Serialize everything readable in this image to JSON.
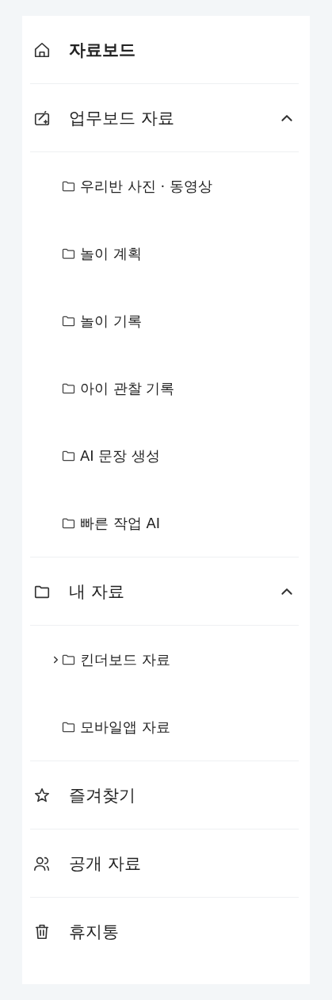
{
  "sidebar": {
    "items": [
      {
        "kind": "link",
        "label": "자료보드",
        "selected": true
      },
      {
        "kind": "group",
        "label": "업무보드 자료",
        "selected": false,
        "expanded": true,
        "children": [
          {
            "label": "우리반 사진 · 동영상",
            "expandable": false
          },
          {
            "label": "놀이 계획",
            "expandable": false
          },
          {
            "label": "놀이 기록",
            "expandable": false
          },
          {
            "label": "아이 관찰 기록",
            "expandable": false
          },
          {
            "label": "AI 문장 생성",
            "expandable": false
          },
          {
            "label": "빠른 작업 AI",
            "expandable": false
          }
        ]
      },
      {
        "kind": "group",
        "label": "내 자료",
        "selected": false,
        "expanded": true,
        "children": [
          {
            "label": "킨더보드 자료",
            "expandable": true,
            "expanded": false
          },
          {
            "label": "모바일앱 자료",
            "expandable": false
          }
        ]
      },
      {
        "kind": "link",
        "label": "즐겨찾기",
        "selected": false
      },
      {
        "kind": "link",
        "label": "공개 자료",
        "selected": false
      },
      {
        "kind": "link",
        "label": "휴지통",
        "selected": false
      }
    ]
  }
}
